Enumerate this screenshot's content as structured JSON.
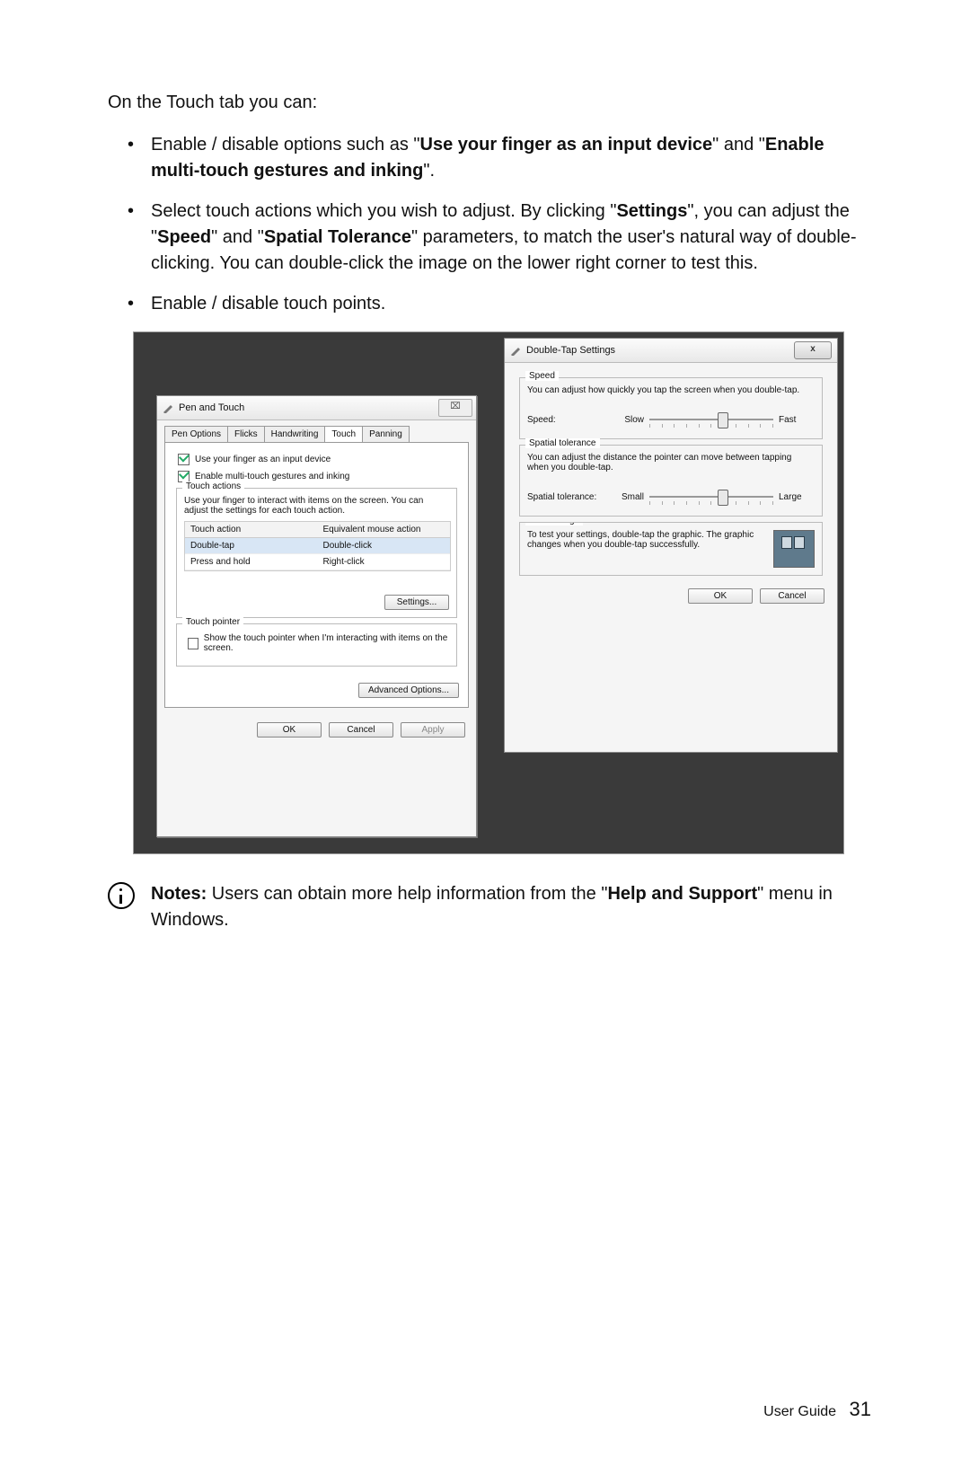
{
  "intro": "On the Touch tab you can:",
  "bullets": [
    {
      "pre": "Enable / disable options such as \"",
      "b1": "Use your finger as an input device",
      "mid": "\" and \"",
      "b2": "Enable multi-touch gestures and inking",
      "post": "\"."
    },
    {
      "pre": "Select touch actions which you wish to adjust. By clicking \"",
      "b1": "Settings",
      "mid": "\", you can adjust the \"",
      "b2": "Speed",
      "mid2": "\" and \"",
      "b3": "Spatial Tolerance",
      "post": "\" parameters, to match the user's natural way of double-clicking. You can double-click the image on the lower right corner to test this."
    },
    {
      "plain": "Enable / disable touch points."
    }
  ],
  "win1": {
    "title": "Pen and Touch",
    "close": "⌧",
    "tabs": [
      "Pen Options",
      "Flicks",
      "Handwriting",
      "Touch",
      "Panning"
    ],
    "chk1": "Use your finger as an input device",
    "chk2": "Enable multi-touch gestures and inking",
    "touchActions": {
      "legend": "Touch actions",
      "desc": "Use your finger to interact with items on the screen. You can adjust the settings for each touch action.",
      "hdr1": "Touch action",
      "hdr2": "Equivalent mouse action",
      "r1a": "Double-tap",
      "r1b": "Double-click",
      "r2a": "Press and hold",
      "r2b": "Right-click",
      "settings": "Settings..."
    },
    "touchPointer": {
      "legend": "Touch pointer",
      "chk": "Show the touch pointer when I'm interacting with items on the screen."
    },
    "adv": "Advanced Options...",
    "ok": "OK",
    "cancel": "Cancel",
    "apply": "Apply"
  },
  "win2": {
    "title": "Double-Tap Settings",
    "close": "x",
    "speed": {
      "legend": "Speed",
      "desc": "You can adjust how quickly you tap the screen when you double-tap.",
      "label": "Speed:",
      "min": "Slow",
      "max": "Fast"
    },
    "spatial": {
      "legend": "Spatial tolerance",
      "desc": "You can adjust the distance the pointer can move between tapping when you double-tap.",
      "label": "Spatial tolerance:",
      "min": "Small",
      "max": "Large"
    },
    "test": {
      "legend": "Test settings",
      "desc": "To test your settings, double-tap the graphic. The graphic changes when you double-tap successfully."
    },
    "ok": "OK",
    "cancel": "Cancel"
  },
  "note": {
    "lead": "Notes:",
    "pre": " Users can obtain more help information from the \"",
    "b": "Help and Support",
    "post": "\" menu in Windows."
  },
  "footer": {
    "label": "User Guide",
    "page": "31"
  }
}
